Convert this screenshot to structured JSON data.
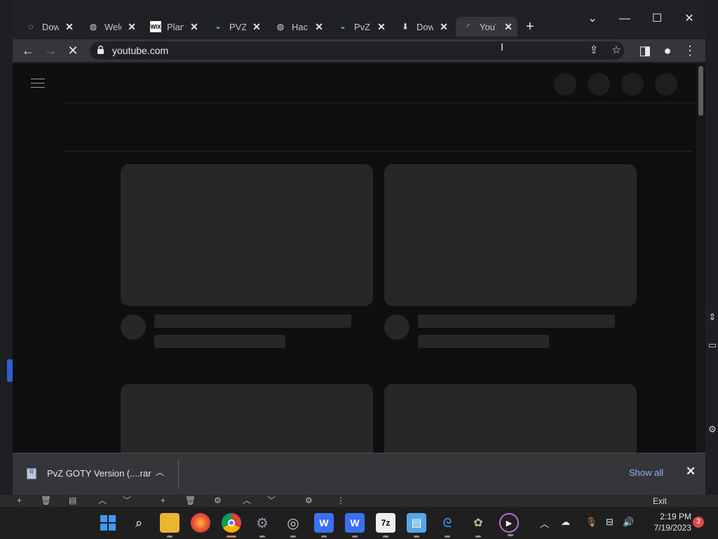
{
  "browser": {
    "tabs": [
      {
        "title": "Dow",
        "icon": "globe-outline-icon"
      },
      {
        "title": "Welc",
        "icon": "globe-icon"
      },
      {
        "title": "Plant",
        "icon": "wix-icon"
      },
      {
        "title": "PVZ",
        "icon": "wavy-blue-icon"
      },
      {
        "title": "Hack",
        "icon": "globe-icon"
      },
      {
        "title": "PvZ",
        "icon": "wavy-blue-icon"
      },
      {
        "title": "Dow",
        "icon": "download-icon"
      },
      {
        "title": "YouT",
        "icon": "loading-spinner-icon",
        "active": true
      }
    ],
    "url": "youtube.com"
  },
  "download_bar": {
    "filename": "PvZ GOTY Version (....rar",
    "show_all": "Show all"
  },
  "taskbar": {
    "time": "2:19 PM",
    "date": "7/19/2023",
    "notification_count": "3",
    "exit_label": "Exit"
  },
  "colors": {
    "page_bg": "#0f0f0f",
    "skeleton": "#272727",
    "link": "#8ab4f8",
    "chrome_toolbar": "#35363a"
  }
}
